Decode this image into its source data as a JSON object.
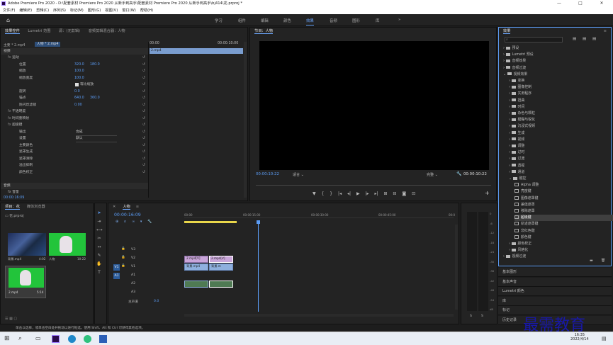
{
  "window": {
    "title": "Adobe Premiere Pro 2020 - D:\\配套素材 Premiere Pro 2020 从新手到高手\\配套素材 Premiere Pro 2020 从新手到高手\\bj414\\花.prproj *"
  },
  "menu": [
    "文件(F)",
    "编辑(E)",
    "剪辑(C)",
    "序列(S)",
    "标记(M)",
    "图形(G)",
    "视图(V)",
    "窗口(W)",
    "帮助(H)"
  ],
  "workspaces": [
    "学习",
    "组件",
    "编辑",
    "颜色",
    "效果",
    "音频",
    "图形",
    "库"
  ],
  "active_workspace": "效果",
  "effect_controls": {
    "tabs": [
      "效果控件",
      "Lumetri 范围",
      "源：(无剪辑)",
      "音频剪辑混合器：人物"
    ],
    "breadcrumb": "主要 * 2.mp4",
    "sequence": "人物 * 2.mp4",
    "tc_start": "00:00",
    "tc_end": "00:00:10:00",
    "clip_label": "2.mp4",
    "section_video": "视频",
    "rows": [
      {
        "label": "运动",
        "fx": true
      },
      {
        "label": "位置",
        "v1": "320.0",
        "v2": "180.0"
      },
      {
        "label": "缩放",
        "v1": "100.0"
      },
      {
        "label": "缩放宽度",
        "v1": "100.0"
      },
      {
        "label": "等比缩放",
        "checkbox": true
      },
      {
        "label": "旋转",
        "v1": "0.0"
      },
      {
        "label": "锚点",
        "v1": "640.0",
        "v2": "360.0"
      },
      {
        "label": "防闪烁滤镜",
        "v1": "0.00"
      },
      {
        "label": "不透明度",
        "fx": true
      },
      {
        "label": "时间重映射",
        "fx": true
      },
      {
        "label": "超级键",
        "fx": true
      },
      {
        "label": "输出",
        "dd": "合成"
      },
      {
        "label": "设置",
        "dd": "默认"
      },
      {
        "label": "主要颜色"
      },
      {
        "label": "遮罩生成"
      },
      {
        "label": "遮罩清除"
      },
      {
        "label": "溢出抑制"
      },
      {
        "label": "颜色校正"
      }
    ],
    "section_audio": "音频",
    "audio_row": "音量",
    "footer_tc": "00:00:16:09"
  },
  "program": {
    "title": "节目：人物",
    "timecode": "00:00:10:22",
    "fit": "适合",
    "quality": "完整",
    "duration": "00:00:10:22"
  },
  "project": {
    "tabs": [
      "项目：花",
      "媒体浏览器"
    ],
    "file": "花.prproj",
    "items": [
      {
        "name": "背景.mp4",
        "dur": "4:02"
      },
      {
        "name": "人物",
        "dur": "10:22"
      },
      {
        "name": "2.mp4",
        "dur": "5:14"
      }
    ]
  },
  "timeline": {
    "name": "人物",
    "timecode": "00:00:16:09",
    "ruler": [
      "00:00",
      "00:00:15:00",
      "00:00:30:00",
      "00:00:45:00",
      "00:0"
    ],
    "tracks": [
      "V3",
      "V2",
      "V1",
      "A1",
      "A2",
      "A3"
    ],
    "master": "主声道",
    "master_val": "0.0",
    "clips": {
      "v2a": "2.mp4[V]",
      "v2b": "2.mp4[V]",
      "v1a": "背景.mp4",
      "v1b": "背景.m"
    }
  },
  "meter": {
    "ticks": [
      "0",
      "-6",
      "-12",
      "-18",
      "-24",
      "-30",
      "-36",
      "-42",
      "-48",
      "-54",
      "dB"
    ],
    "bottom": [
      "S",
      "S"
    ]
  },
  "effects": {
    "title": "效果",
    "items": [
      {
        "label": "预设",
        "level": 0,
        "open": false
      },
      {
        "label": "Lumetri 预设",
        "level": 0,
        "open": false
      },
      {
        "label": "音频效果",
        "level": 0,
        "open": false
      },
      {
        "label": "音频过渡",
        "level": 0,
        "open": false
      },
      {
        "label": "视频效果",
        "level": 0,
        "open": true
      },
      {
        "label": "变换",
        "level": 1
      },
      {
        "label": "图像控制",
        "level": 1
      },
      {
        "label": "实用程序",
        "level": 1
      },
      {
        "label": "扭曲",
        "level": 1
      },
      {
        "label": "时间",
        "level": 1
      },
      {
        "label": "杂色与颗粒",
        "level": 1
      },
      {
        "label": "模糊与锐化",
        "level": 1
      },
      {
        "label": "沉浸式视频",
        "level": 1
      },
      {
        "label": "生成",
        "level": 1
      },
      {
        "label": "视频",
        "level": 1
      },
      {
        "label": "调整",
        "level": 1
      },
      {
        "label": "过时",
        "level": 1
      },
      {
        "label": "过渡",
        "level": 1
      },
      {
        "label": "透视",
        "level": 1
      },
      {
        "label": "通道",
        "level": 1
      },
      {
        "label": "键控",
        "level": 1,
        "open": true
      },
      {
        "label": "Alpha 调整",
        "level": 2
      },
      {
        "label": "亮度键",
        "level": 2
      },
      {
        "label": "图像遮罩键",
        "level": 2
      },
      {
        "label": "差值遮罩",
        "level": 2
      },
      {
        "label": "移除遮罩",
        "level": 2
      },
      {
        "label": "超级键",
        "level": 2,
        "selected": true
      },
      {
        "label": "轨道遮罩键",
        "level": 2
      },
      {
        "label": "非红色键",
        "level": 2
      },
      {
        "label": "颜色键",
        "level": 2
      },
      {
        "label": "颜色校正",
        "level": 1
      },
      {
        "label": "风格化",
        "level": 1
      },
      {
        "label": "视频过渡",
        "level": 0,
        "open": false
      }
    ],
    "panels": [
      "基本图形",
      "基本声音",
      "Lumetri 颜色",
      "库",
      "标记",
      "历史记录"
    ]
  },
  "status": "单击以选择，或单击空白处并拖动以进行框选。使用 Shift、Alt 和 Ctrl 可获得其他选项。",
  "taskbar": {
    "time": "16:35",
    "date": "2022/4/14"
  },
  "watermark": "最需教育"
}
